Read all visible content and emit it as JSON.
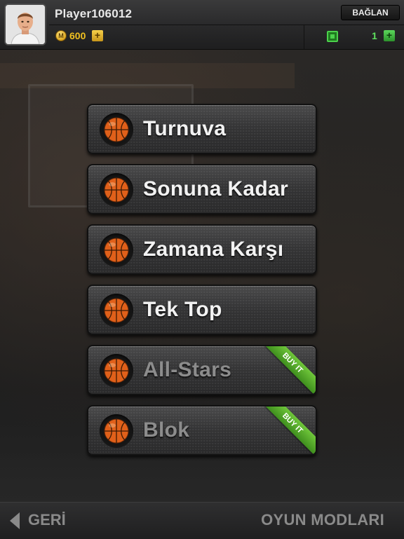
{
  "header": {
    "player_name": "Player106012",
    "connect_label": "BAĞLAN",
    "coins": "600",
    "coin_symbol": "M",
    "coin_plus": "+",
    "tickets": "1",
    "ticket_plus": "+"
  },
  "menu": {
    "items": [
      {
        "label": "Turnuva",
        "locked": false
      },
      {
        "label": "Sonuna Kadar",
        "locked": false
      },
      {
        "label": "Zamana Karşı",
        "locked": false
      },
      {
        "label": "Tek Top",
        "locked": false
      },
      {
        "label": "All-Stars",
        "locked": true,
        "badge": "BUY IT"
      },
      {
        "label": "Blok",
        "locked": true,
        "badge": "BUY IT"
      }
    ]
  },
  "footer": {
    "back_label": "GERİ",
    "screen_title": "OYUN MODLARI"
  },
  "icons": {
    "avatar": "player-avatar",
    "coin": "coin-icon",
    "ticket": "ticket-icon",
    "ball": "basketball-icon",
    "back": "back-arrow-icon"
  },
  "colors": {
    "coin": "#f0c020",
    "ticket": "#5ee05e",
    "badge": "#4f9f2a",
    "ball": "#e0601a"
  }
}
